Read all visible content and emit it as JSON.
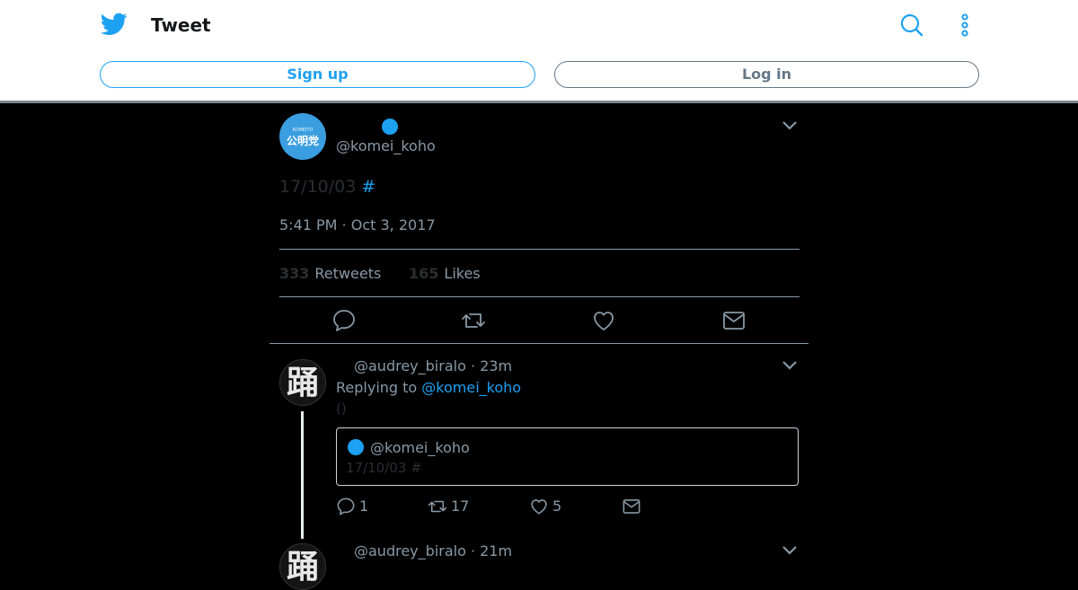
{
  "header": {
    "title": "Tweet",
    "signup_label": "Sign up",
    "login_label": "Log in"
  },
  "main_tweet": {
    "avatar_small": "KOMEITO",
    "avatar_text": "公明党",
    "handle": "@komei_koho",
    "text": "17/10/03",
    "hashtag": "#",
    "timestamp": "5:41 PM · Oct 3, 2017",
    "retweets_count": "333",
    "retweets_label": "Retweets",
    "likes_count": "165",
    "likes_label": "Likes"
  },
  "reply1": {
    "avatar_char": "踊",
    "handle_time": "@audrey_biralo · 23m",
    "replying_prefix": "Replying to",
    "replying_to": "@komei_koho",
    "body": "()",
    "quote_handle": "@komei_koho",
    "quote_text": "17/10/03 #",
    "reply_count": "1",
    "retweet_count": "17",
    "like_count": "5"
  },
  "reply2": {
    "avatar_char": "踊",
    "handle_time": "@audrey_biralo · 21m"
  },
  "icons": {
    "brand": "twitter-bird-icon",
    "search": "search-icon",
    "more": "more-vertical-icon",
    "reply": "reply-icon",
    "retweet": "retweet-icon",
    "like": "heart-icon",
    "dm": "mail-icon",
    "expand": "chevron-down-icon"
  },
  "colors": {
    "accent": "#1da1f2",
    "secondary_text": "#8899a6",
    "background": "#000000"
  }
}
